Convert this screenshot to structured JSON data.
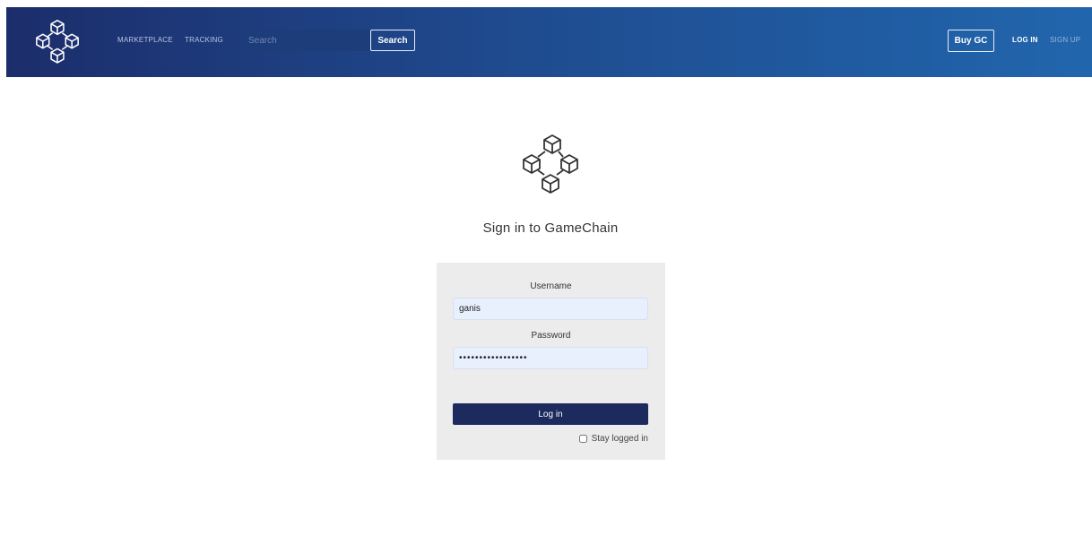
{
  "nav": {
    "links": [
      {
        "label": "MARKETPLACE"
      },
      {
        "label": "TRACKING"
      }
    ],
    "search": {
      "placeholder": "Search",
      "value": "",
      "button_label": "Search"
    },
    "buy_label": "Buy GC",
    "login_label": "LOG IN",
    "signup_label": "SIGN UP",
    "logo_icon": "blockchain-cubes-icon"
  },
  "main": {
    "logo_icon": "blockchain-cubes-icon",
    "title": "Sign in to GameChain",
    "form": {
      "username_label": "Username",
      "username_value": "ganis",
      "password_label": "Password",
      "password_value": "ganispassword1234",
      "submit_label": "Log in",
      "stay_logged_label": "Stay logged in",
      "stay_logged_checked": false
    }
  },
  "colors": {
    "nav_gradient_start": "#1c2d6b",
    "nav_gradient_end": "#2166ad",
    "login_button": "#1c2a5e",
    "panel_bg": "#ececec",
    "input_bg": "#e8f0fe"
  }
}
